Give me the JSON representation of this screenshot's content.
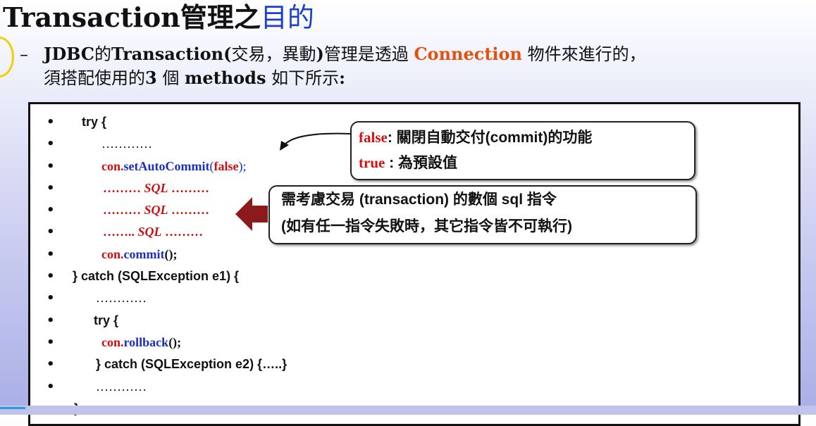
{
  "title": {
    "main": "Transaction管理之",
    "accent": "目的"
  },
  "intro": {
    "dash": "–",
    "line1_a": "JDBC",
    "line1_b": "的",
    "line1_c": "Transaction(",
    "line1_d": "交易，異動",
    "line1_e": ")",
    "line1_f": "管理是透過 ",
    "line1_conn": "Connection",
    "line1_g": " 物件來進行的，",
    "line2_a": "須搭配使用的",
    "line2_b": "3",
    "line2_c": " 個 ",
    "line2_d": "methods",
    "line2_e": " 如下所示",
    "line2_f": ":"
  },
  "bullet": "•",
  "code": {
    "l1": "try {",
    "l2": "…………",
    "l3_con": "con.",
    "l3_method": "setAutoCommit",
    "l3_open": "(",
    "l3_arg": "false",
    "l3_close": ");",
    "l4_pre": "……… ",
    "l4_sql": "SQL",
    "l4_post": " ………",
    "l5_pre": "……… ",
    "l5_sql": "SQL",
    "l5_post": " ………",
    "l6_pre": "…….. ",
    "l6_sql": "SQL",
    "l6_post": " ………",
    "l7_con": "con.",
    "l7_method": "commit",
    "l7_rest": "();",
    "l8": "} catch (SQLException e1) {",
    "l9": "…………",
    "l10": "try {",
    "l11_con": "con.",
    "l11_method": "rollback",
    "l11_rest": "();",
    "l12": "} catch (SQLException e2) {…..}",
    "l13": "…………",
    "l14": "}"
  },
  "callout1": {
    "false_kw": "false",
    "false_text": ": 關閉自動交付(commit)的功能",
    "true_kw": "true",
    "true_text": " : 為預設值"
  },
  "callout2": {
    "line1": "需考慮交易 (transaction) 的數個 sql 指令",
    "line2": "(如有任一指令失敗時，其它指令皆不可執行)"
  },
  "colors": {
    "accent_blue": "#1a3fd0",
    "connection_orange": "#e2520e",
    "code_red": "#cc1010",
    "code_blue": "#1a2fc0",
    "arrow_red": "#8b1a1a"
  }
}
